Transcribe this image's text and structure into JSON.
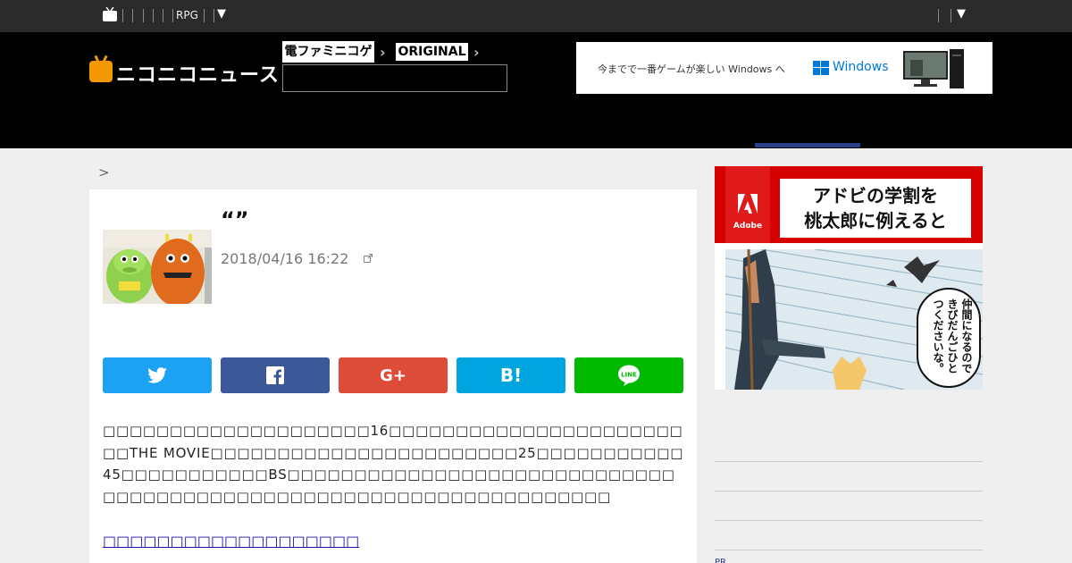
{
  "topbar": {
    "game_genre": "RPG",
    "dropdown_arrow": "▼"
  },
  "header": {
    "site_name": "ニコニコニュース",
    "partner_label": "電ファミニコゲーマー",
    "original_label": "ORIGINAL",
    "search_placeholder": ""
  },
  "banner_ad": {
    "text": "今までで一番ゲームが楽しい Windows へ",
    "brand": "Windows"
  },
  "breadcrumb": {
    "separator": ">"
  },
  "article": {
    "title": "“”",
    "date": "2018/04/16 16:22",
    "body": "□□□□□□□□□□□□□□□□□□□□16□□□□□□□□□□□□□□□□□□□□□□□□THE MOVIE□□□□□□□□□□□□□□□□□□□□□□□25□□□□□□□□□□□45□□□□□□□□□□□BS□□□□□□□□□□□□□□□□□□□□□□□□□□□□□□□□□□□□□□□□□□□□□□□□□□□□□□□□□□□□□□□□□□□",
    "more_link": "□□□□□□□□□□□□□□□□□□□"
  },
  "share": {
    "buttons": [
      {
        "name": "twitter",
        "label": "",
        "color": "#1da1f2"
      },
      {
        "name": "facebook",
        "label": "",
        "color": "#3b5998"
      },
      {
        "name": "googleplus",
        "label": "G+",
        "color": "#dd4b39"
      },
      {
        "name": "hatena",
        "label": "B!",
        "color": "#00a4de"
      },
      {
        "name": "line",
        "label": "LINE",
        "color": "#00b900"
      }
    ]
  },
  "side_ad": {
    "brand": "Adobe",
    "headline_1": "アドビの学割を",
    "headline_2": "桃太郎に例えると",
    "bubble": "仲間になるのできびだんごひとつくださいな。"
  },
  "sidebar": {
    "label": "PR"
  }
}
